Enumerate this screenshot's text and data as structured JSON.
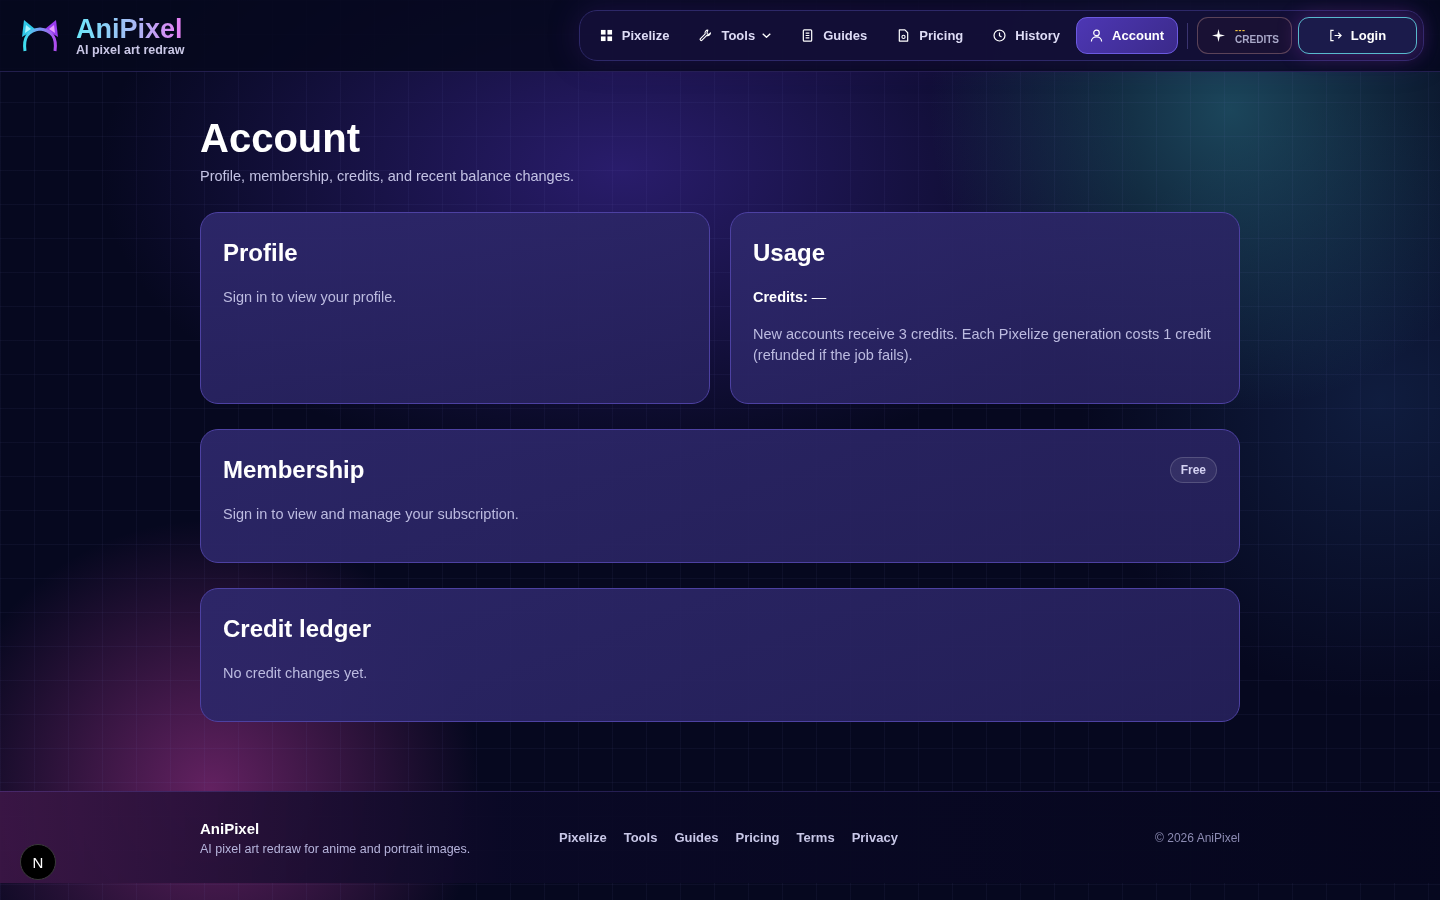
{
  "header": {
    "brand": {
      "title": "AniPixel",
      "tagline": "AI pixel art redraw"
    },
    "nav": [
      {
        "label": "Pixelize",
        "kind": "link",
        "selected": false
      },
      {
        "label": "Tools",
        "kind": "menu",
        "selected": false
      },
      {
        "label": "Guides",
        "kind": "link",
        "selected": false
      },
      {
        "label": "Pricing",
        "kind": "link",
        "selected": false
      },
      {
        "label": "History",
        "kind": "link",
        "selected": false
      },
      {
        "label": "Account",
        "kind": "link",
        "selected": true
      }
    ],
    "credits": {
      "value": "---",
      "label": "CREDITS"
    },
    "login": {
      "label": "Login"
    }
  },
  "page": {
    "title": "Account",
    "subtitle": "Profile, membership, credits, and recent balance changes."
  },
  "profile": {
    "title": "Profile",
    "text": "Sign in to view your profile."
  },
  "usage": {
    "title": "Usage",
    "credits": "**Credits:** —",
    "note": "New accounts receive 3 credits. Each Pixelize generation costs 1 credit (refunded if the job fails)."
  },
  "membership": {
    "title": "Membership",
    "badge": "Free",
    "text": "Sign in to view and manage your subscription."
  },
  "credit_ledger": {
    "title": "Credit ledger",
    "text": "No credit changes yet."
  },
  "footer": {
    "brand": "AniPixel",
    "tagline": "AI pixel art redraw for anime and portrait images.",
    "links": [
      "Pixelize",
      "Tools",
      "Guides",
      "Pricing",
      "Terms",
      "Privacy"
    ],
    "copyright": "© 2026 AniPixel"
  },
  "dev_indicator": {
    "label": "N"
  }
}
